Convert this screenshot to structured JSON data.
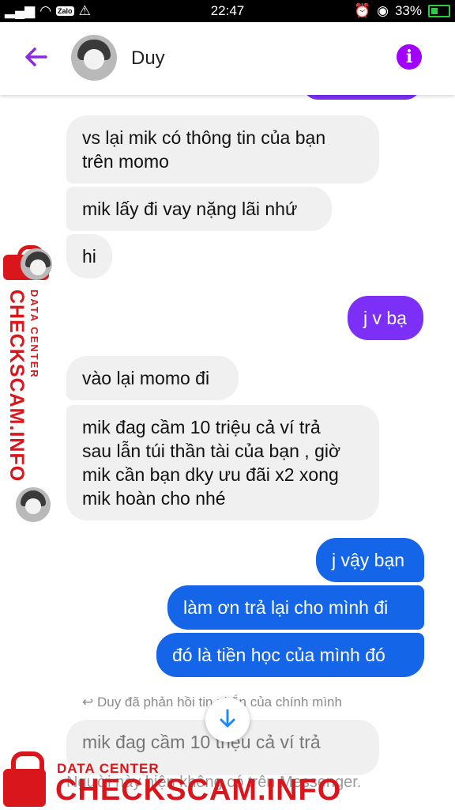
{
  "status_bar": {
    "time": "22:47",
    "battery": "33%",
    "icons": [
      "signal-icon",
      "wifi-icon",
      "zalo-icon",
      "warning-icon",
      "alarm-icon",
      "eye-icon",
      "battery-icon"
    ],
    "zalo_label": "Zalo"
  },
  "header": {
    "contact_name": "Duy",
    "accent_color": "#a100ff"
  },
  "messages": [
    {
      "side": "in",
      "text": "vs lại mik có thông tin của bạn\ntrên momo"
    },
    {
      "side": "in",
      "text": "mik lấy đi vay nặng lãi nhứ"
    },
    {
      "side": "in",
      "text": "hi"
    },
    {
      "side": "out",
      "text": "j v bạ"
    },
    {
      "side": "in",
      "text": "vào lại momo đi"
    },
    {
      "side": "in",
      "text": "mik đag cầm 10 triệu cả ví trả\nsau lẫn túi thần tài của bạn , giờ\nmik cần bạn dky ưu đãi x2 xong\nmik hoàn cho nhé"
    },
    {
      "side": "out",
      "text": "j vậy bạn"
    },
    {
      "side": "out",
      "text": "làm ơn trả lại cho mình đi"
    },
    {
      "side": "out",
      "text": "đó là tiền học của mình đó"
    }
  ],
  "reply_note": "Duy đã phản hồi tin nhắn của chính mình",
  "quoted_message": "mik đag cầm 10 triệu cả ví trả",
  "footer_note": "Người này hiện không có trên Messenger.",
  "watermark": {
    "line1": "DATA CENTER",
    "line2": "CHECKSCAM.INFO",
    "color": "#d9161c"
  },
  "colors": {
    "outgoing_purple": "#7b2ff7",
    "outgoing_blue": "#1565e8",
    "incoming": "#f0f0f0"
  }
}
